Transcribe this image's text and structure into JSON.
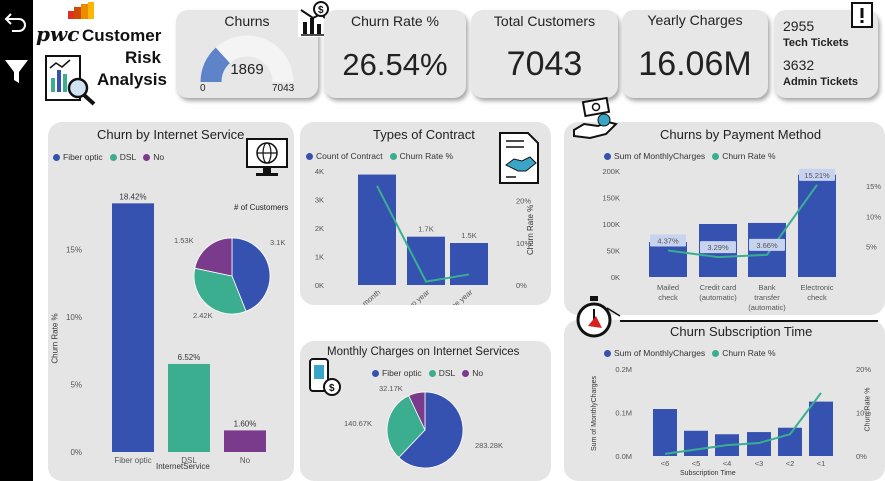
{
  "brand": {
    "logo_text": "pwc",
    "title_lines": [
      "Customer",
      "Risk",
      "Analysis"
    ]
  },
  "kpis": {
    "churns": {
      "title": "Churns",
      "value": "1869",
      "min": "0",
      "max": "7043",
      "fraction": 0.2654
    },
    "churn_rate": {
      "title": "Churn Rate %",
      "value": "26.54%"
    },
    "total_customers": {
      "title": "Total Customers",
      "value": "7043"
    },
    "yearly_charges": {
      "title": "Yearly Charges",
      "value": "16.06M"
    },
    "tickets": [
      {
        "value": "2955",
        "label": "Tech Tickets"
      },
      {
        "value": "3632",
        "label": "Admin Tickets"
      }
    ]
  },
  "colors": {
    "blue": "#3552b0",
    "teal": "#3bae8f",
    "purple": "#7b3b8c",
    "gauge_fill": "#5f83c9",
    "gauge_track": "#f4f4f4",
    "line": "#3aae91",
    "label_box": "#c7d3ef"
  },
  "internet_service": {
    "title": "Churn by Internet Service",
    "legend": [
      "Fiber optic",
      "DSL",
      "No"
    ],
    "xlabel": "InternetService",
    "ylabel": "Churn Rate %",
    "yticks": [
      "0%",
      "5%",
      "10%",
      "15%"
    ],
    "pie_title": "# of Customers"
  },
  "contract": {
    "title": "Types of Contract",
    "legend": [
      "Count of Contract",
      "Churn Rate %"
    ],
    "left_ticks": [
      "0K",
      "1K",
      "2K",
      "3K",
      "4K"
    ],
    "right_ticks": [
      "0%",
      "10%",
      "20%"
    ],
    "right_label": "Churn Rate %"
  },
  "monthly_internet": {
    "title": "Monthly Charges on Internet Services",
    "legend": [
      "Fiber optic",
      "DSL",
      "No"
    ]
  },
  "payment": {
    "title": "Churns by Payment Method",
    "legend": [
      "Sum of MonthlyCharges",
      "Churn Rate %"
    ],
    "left_ticks": [
      "0K",
      "50K",
      "100K",
      "150K",
      "200K"
    ],
    "right_ticks": [
      "5%",
      "10%",
      "15%"
    ]
  },
  "subscription": {
    "title": "Churn Subscription Time",
    "legend": [
      "Sum of MonthlyCharges",
      "Churn Rate %"
    ],
    "left_ticks": [
      "0.0M",
      "0.1M",
      "0.2M"
    ],
    "right_ticks": [
      "0%",
      "10%",
      "20%"
    ],
    "xlabel": "Subscription Time",
    "ylabel": "Sum of MonthlyCharges",
    "right_label": "Churn Rate %"
  },
  "chart_data": [
    {
      "type": "bar",
      "title": "Churn by Internet Service",
      "categories": [
        "Fiber optic",
        "DSL",
        "No"
      ],
      "values": [
        18.42,
        6.52,
        1.6
      ],
      "value_labels": [
        "18.42%",
        "6.52%",
        "1.60%"
      ],
      "xlabel": "InternetService",
      "ylabel": "Churn Rate %",
      "ylim": [
        0,
        20
      ]
    },
    {
      "type": "pie",
      "title": "# of Customers",
      "categories": [
        "Fiber optic",
        "DSL",
        "No"
      ],
      "values": [
        3.1,
        2.42,
        1.53
      ],
      "value_labels": [
        "3.1K",
        "2.42K",
        "1.53K"
      ]
    },
    {
      "type": "bar",
      "title": "Types of Contract",
      "categories": [
        "Month-to-month",
        "Two year",
        "One year"
      ],
      "series": [
        {
          "name": "Count of Contract",
          "type": "bar",
          "values": [
            3875,
            1695,
            1473
          ],
          "value_labels": [
            "",
            "1.7K",
            "1.5K"
          ]
        },
        {
          "name": "Churn Rate %",
          "type": "line",
          "values": [
            23.5,
            0.8,
            2.5
          ]
        }
      ],
      "ylim": [
        0,
        4000
      ],
      "y2lim": [
        0,
        27
      ]
    },
    {
      "type": "pie",
      "title": "Monthly Charges on Internet Services",
      "categories": [
        "Fiber optic",
        "DSL",
        "No"
      ],
      "values": [
        283.28,
        140.67,
        32.17
      ],
      "value_labels": [
        "283.28K",
        "140.67K",
        "32.17K"
      ]
    },
    {
      "type": "bar",
      "title": "Churns by Payment Method",
      "categories": [
        "Mailed check",
        "Credit card (automatic)",
        "Bank transfer (automatic)",
        "Electronic check"
      ],
      "series": [
        {
          "name": "Sum of MonthlyCharges",
          "type": "bar",
          "values": [
            66,
            100,
            102,
            193
          ]
        },
        {
          "name": "Churn Rate %",
          "type": "line",
          "values": [
            4.37,
            3.29,
            3.66,
            15.21
          ],
          "value_labels": [
            "4.37%",
            "3.29%",
            "3.66%",
            "15.21%"
          ]
        }
      ],
      "ylim": [
        0,
        200
      ],
      "y2lim": [
        0,
        17.5
      ]
    },
    {
      "type": "bar",
      "title": "Churn Subscription Time",
      "categories": [
        "<6",
        "<5",
        "<4",
        "<3",
        "<2",
        "<1"
      ],
      "series": [
        {
          "name": "Sum of MonthlyCharges",
          "type": "bar",
          "values": [
            0.108,
            0.058,
            0.05,
            0.055,
            0.065,
            0.125
          ]
        },
        {
          "name": "Churn Rate %",
          "type": "line",
          "values": [
            0.5,
            1.5,
            2.5,
            3.0,
            5.0,
            14.5
          ]
        }
      ],
      "xlabel": "Subscription Time",
      "ylabel": "Sum of MonthlyCharges",
      "ylim": [
        0,
        0.2
      ],
      "y2lim": [
        0,
        20
      ]
    }
  ]
}
